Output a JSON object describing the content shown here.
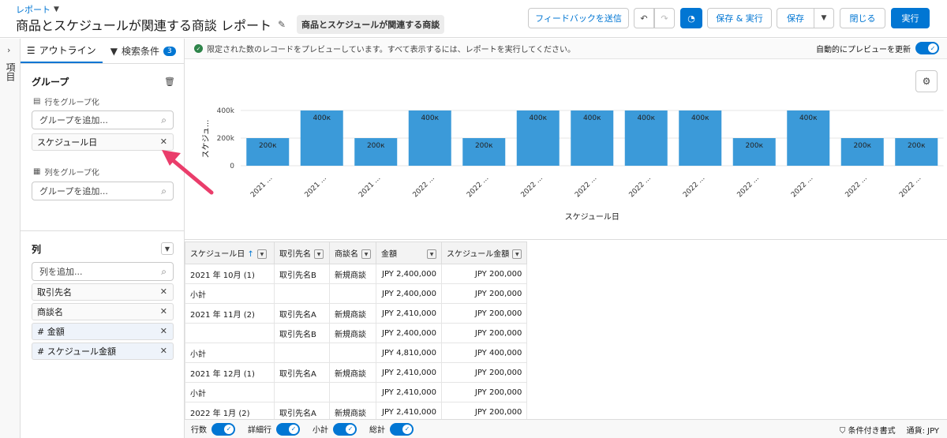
{
  "header": {
    "breadcrumb": "レポート",
    "title": "商品とスケジュールが関連する商談 レポート",
    "report_type": "商品とスケジュールが関連する商談",
    "feedback": "フィードバックを送信",
    "save_run": "保存 & 実行",
    "save": "保存",
    "close": "閉じる",
    "run": "実行"
  },
  "rail": {
    "label": "項目"
  },
  "panel": {
    "tab_outline": "アウトライン",
    "tab_filters": "検索条件",
    "filter_count": "3",
    "groups_title": "グループ",
    "group_rows": "行をグループ化",
    "group_add_placeholder": "グループを追加...",
    "row_group_item": "スケジュール日",
    "group_cols": "列をグループ化",
    "col_add_placeholder": "グループを追加...",
    "columns_title": "列",
    "columns_add_placeholder": "列を追加...",
    "columns": [
      "取引先名",
      "商談名",
      "# 金額",
      "# スケジュール金額"
    ]
  },
  "notice": {
    "text": "限定された数のレコードをプレビューしています。すべて表示するには、レポートを実行してください。",
    "auto_refresh": "自動的にプレビューを更新"
  },
  "chart_data": {
    "type": "bar",
    "xlabel": "スケジュール日",
    "ylabel": "スケジュ...",
    "ylim": [
      0,
      400000
    ],
    "yticks": [
      "400k",
      "200k",
      "0"
    ],
    "categories": [
      "2021 ...",
      "2021 ...",
      "2021 ...",
      "2022 ...",
      "2022 ...",
      "2022 ...",
      "2022 ...",
      "2022 ...",
      "2022 ...",
      "2022 ...",
      "2022 ...",
      "2022 ...",
      "2022 ..."
    ],
    "values": [
      200000,
      400000,
      200000,
      400000,
      200000,
      400000,
      400000,
      400000,
      400000,
      200000,
      400000,
      200000,
      200000
    ],
    "labels": [
      "200к",
      "400к",
      "200к",
      "400к",
      "200к",
      "400к",
      "400к",
      "400к",
      "400к",
      "200к",
      "400к",
      "200к",
      "200к"
    ],
    "color": "#3b9ad9",
    "grid": true
  },
  "table": {
    "headers": [
      "スケジュール日",
      "取引先名",
      "商談名",
      "金額",
      "スケジュール金額"
    ],
    "rows": [
      [
        "2021 年 10月 (1)",
        "取引先名B",
        "新規商談",
        "JPY 2,400,000",
        "JPY 200,000"
      ],
      [
        "小計",
        "",
        "",
        "JPY 2,400,000",
        "JPY 200,000"
      ],
      [
        "2021 年 11月 (2)",
        "取引先名A",
        "新規商談",
        "JPY 2,410,000",
        "JPY 200,000"
      ],
      [
        "",
        "取引先名B",
        "新規商談",
        "JPY 2,400,000",
        "JPY 200,000"
      ],
      [
        "小計",
        "",
        "",
        "JPY 4,810,000",
        "JPY 400,000"
      ],
      [
        "2021 年 12月 (1)",
        "取引先名A",
        "新規商談",
        "JPY 2,410,000",
        "JPY 200,000"
      ],
      [
        "小計",
        "",
        "",
        "JPY 2,410,000",
        "JPY 200,000"
      ],
      [
        "2022 年 1月 (2)",
        "取引先名A",
        "新規商談",
        "JPY 2,410,000",
        "JPY 200,000"
      ]
    ]
  },
  "footer": {
    "rows": "行数",
    "detail": "詳細行",
    "subtotal": "小計",
    "grand": "総計",
    "conditional": "条件付き書式",
    "currency": "通貨: JPY"
  }
}
